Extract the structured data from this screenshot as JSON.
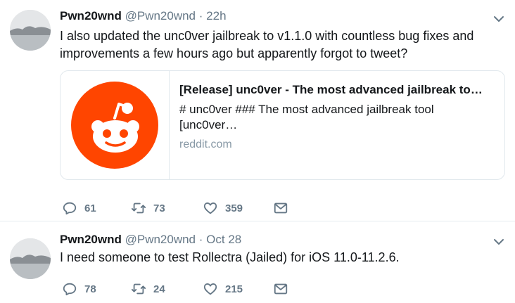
{
  "tweets": [
    {
      "display_name": "Pwn20wnd",
      "handle": "@Pwn20wnd",
      "separator": "·",
      "time": "22h",
      "text": "I also updated the unc0ver jailbreak to v1.1.0 with countless bug fixes and improvements a few hours ago but apparently forgot to tweet?",
      "card": {
        "title": "[Release] unc0ver - The most advanced jailbreak to…",
        "description": "# unc0ver ### The most advanced jailbreak tool [unc0ver…",
        "domain": "reddit.com",
        "thumb_icon": "reddit-logo-icon",
        "thumb_color": "#ff4500"
      },
      "replies": "61",
      "retweets": "73",
      "likes": "359"
    },
    {
      "display_name": "Pwn20wnd",
      "handle": "@Pwn20wnd",
      "separator": "·",
      "time": "Oct 28",
      "text": "I need someone to test Rollectra (Jailed) for iOS 11.0-11.2.6.",
      "replies": "78",
      "retweets": "24",
      "likes": "215"
    }
  ],
  "colors": {
    "text": "#14171a",
    "secondary": "#657786",
    "border": "#e6ecf0",
    "reddit": "#ff4500"
  }
}
